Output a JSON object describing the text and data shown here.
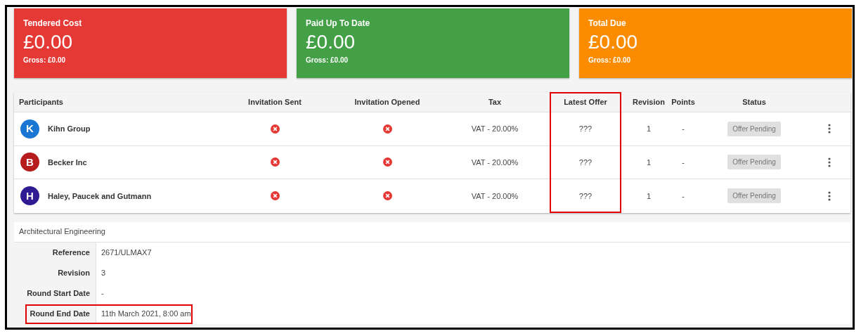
{
  "cards": [
    {
      "title": "Tendered Cost",
      "amount": "£0.00",
      "gross": "Gross: £0.00",
      "color": "#e53935"
    },
    {
      "title": "Paid Up To Date",
      "amount": "£0.00",
      "gross": "Gross: £0.00",
      "color": "#43a047"
    },
    {
      "title": "Total Due",
      "amount": "£0.00",
      "gross": "Gross: £0.00",
      "color": "#fb8c00"
    }
  ],
  "table": {
    "columns": [
      {
        "label": "Participants",
        "highlighted": false
      },
      {
        "label": "Invitation Sent",
        "highlighted": false
      },
      {
        "label": "Invitation Opened",
        "highlighted": false
      },
      {
        "label": "Tax",
        "highlighted": false
      },
      {
        "label": "Latest Offer",
        "highlighted": true
      },
      {
        "label": "Revision",
        "highlighted": false
      },
      {
        "label": "Points",
        "highlighted": false
      },
      {
        "label": "Status",
        "highlighted": false
      }
    ],
    "rows": [
      {
        "initial": "K",
        "color": "#1976d2",
        "name": "Kihn Group",
        "invitation_sent": false,
        "invitation_opened": false,
        "tax": "VAT - 20.00%",
        "latest_offer": "???",
        "revision": "1",
        "points": "-",
        "status": "Offer Pending"
      },
      {
        "initial": "B",
        "color": "#b71c1c",
        "name": "Becker Inc",
        "invitation_sent": false,
        "invitation_opened": false,
        "tax": "VAT - 20.00%",
        "latest_offer": "???",
        "revision": "1",
        "points": "-",
        "status": "Offer Pending"
      },
      {
        "initial": "H",
        "color": "#311b92",
        "name": "Haley, Paucek and Gutmann",
        "invitation_sent": false,
        "invitation_opened": false,
        "tax": "VAT - 20.00%",
        "latest_offer": "???",
        "revision": "1",
        "points": "-",
        "status": "Offer Pending"
      }
    ]
  },
  "details": {
    "title": "Architectural Engineering",
    "fields": [
      {
        "label": "Reference",
        "value": "2671/ULMAX7",
        "highlighted": false
      },
      {
        "label": "Revision",
        "value": "3",
        "highlighted": false
      },
      {
        "label": "Round Start Date",
        "value": "-",
        "highlighted": false
      },
      {
        "label": "Round End Date",
        "value": "11th March 2021, 8:00 am",
        "highlighted": true
      }
    ]
  }
}
